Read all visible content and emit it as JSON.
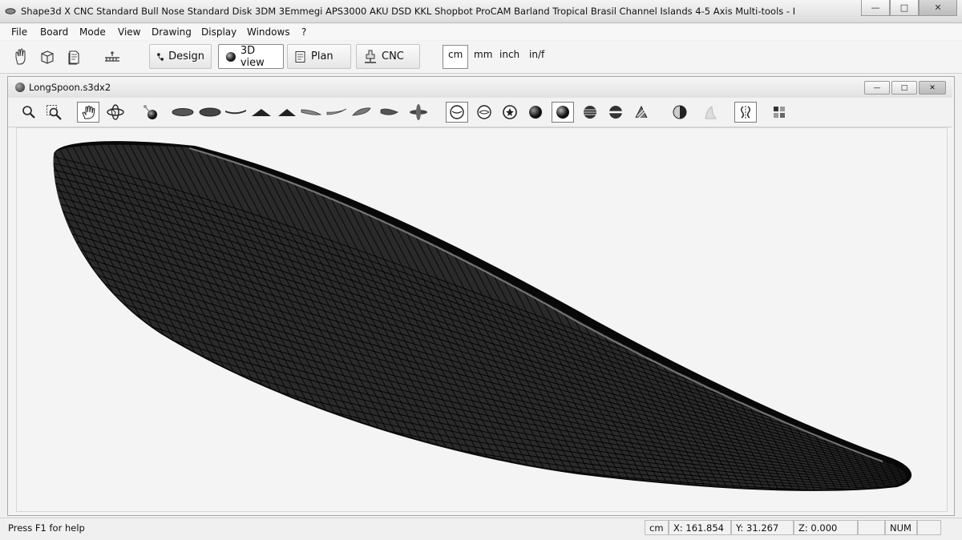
{
  "window": {
    "title": "Shape3d X CNC  Standard Bull Nose Standard Disk 3DM 3Emmegi APS3000 AKU DSD KKL Shopbot ProCAM Barland Tropical Brasil Channel Islands 4-5 Axis Multi-tools - I",
    "minimize_label": "—",
    "maximize_label": "□",
    "close_label": "✕"
  },
  "menu": [
    {
      "label": "File",
      "access_key": "F"
    },
    {
      "label": "Board",
      "access_key": "B"
    },
    {
      "label": "Mode",
      "access_key": "M"
    },
    {
      "label": "View",
      "access_key": "V"
    },
    {
      "label": "Drawing",
      "access_key": "D"
    },
    {
      "label": "Display",
      "access_key": "D"
    },
    {
      "label": "Windows",
      "access_key": "W"
    },
    {
      "label": "?",
      "access_key": "?"
    }
  ],
  "toolbar": {
    "left_icons": [
      "hand-icon",
      "box-icon",
      "page-icon",
      "scale-icon"
    ],
    "modes": [
      {
        "label": "Design",
        "icon": "design-icon",
        "active": false
      },
      {
        "label": "3D view",
        "icon": "sphere-icon",
        "active": true
      },
      {
        "label": "Plan",
        "icon": "plan-icon",
        "active": false
      },
      {
        "label": "CNC",
        "icon": "cnc-icon",
        "active": false
      }
    ],
    "units": [
      {
        "label": "cm",
        "active": true
      },
      {
        "label": "mm",
        "active": false
      },
      {
        "label": "inch",
        "active": false
      },
      {
        "label": "in/f",
        "active": false
      }
    ]
  },
  "document": {
    "name": "LongSpoon.s3dx2",
    "view_tools": [
      {
        "name": "zoom-icon",
        "active": false
      },
      {
        "name": "zoom-window-icon",
        "active": false
      },
      {
        "name": "pan-hand-icon",
        "active": true
      },
      {
        "name": "rotate-icon",
        "active": false
      },
      {
        "name": "light-icon",
        "active": false
      },
      {
        "name": "view-deck-icon",
        "active": false
      },
      {
        "name": "view-bottom-icon",
        "active": false
      },
      {
        "name": "view-side-icon",
        "active": false
      },
      {
        "name": "view-front-icon",
        "active": false
      },
      {
        "name": "view-back-icon",
        "active": false
      },
      {
        "name": "view-nose-icon",
        "active": false
      },
      {
        "name": "view-tail-icon",
        "active": false
      },
      {
        "name": "view-iso-1-icon",
        "active": false
      },
      {
        "name": "view-iso-2-icon",
        "active": false
      },
      {
        "name": "view-axes-icon",
        "active": false
      },
      {
        "name": "render-wire-icon",
        "active": true
      },
      {
        "name": "render-points-icon",
        "active": false
      },
      {
        "name": "render-gear-icon",
        "active": false
      },
      {
        "name": "render-shaded-icon",
        "active": false
      },
      {
        "name": "render-smooth-icon",
        "active": true
      },
      {
        "name": "render-slices-icon",
        "active": false
      },
      {
        "name": "render-outline-icon",
        "active": false
      },
      {
        "name": "render-curvature-icon",
        "active": false
      },
      {
        "name": "render-zebra-icon",
        "active": false
      },
      {
        "name": "fin-icon",
        "active": false
      },
      {
        "name": "symmetry-icon",
        "active": true
      },
      {
        "name": "grid-icon",
        "active": false
      }
    ]
  },
  "status": {
    "help": "Press F1 for help",
    "unit": "cm",
    "x": "X: 161.854",
    "y": "Y: 31.267",
    "z": "Z: 0.000",
    "num": "NUM"
  },
  "colors": {
    "board_fill": "#2a2a2a",
    "board_rail": "#080808",
    "mesh_line": "#000000",
    "highlight": "#9a9a9a",
    "viewport_bg": "#f4f4f4"
  }
}
